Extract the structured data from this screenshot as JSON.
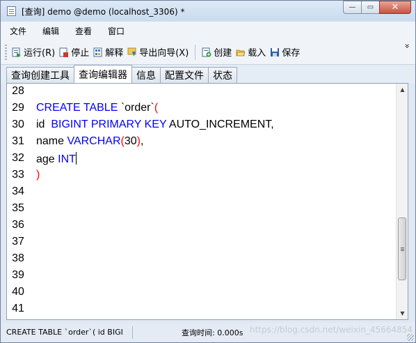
{
  "window": {
    "title": "[查询] demo @demo (localhost_3306) *",
    "minimize_label": "—",
    "restore_label": "▭",
    "close_label": "✕"
  },
  "menu": {
    "items": [
      {
        "label": "文件"
      },
      {
        "label": "编辑"
      },
      {
        "label": "查看"
      },
      {
        "label": "窗口"
      }
    ]
  },
  "toolbar": {
    "run": "运行(R)",
    "stop": "停止",
    "explain": "解释",
    "export_wizard": "导出向导(X)",
    "create": "创建",
    "load": "载入",
    "save": "保存",
    "overflow": "»"
  },
  "tabs": [
    {
      "label": "查询创建工具",
      "active": false
    },
    {
      "label": "查询编辑器",
      "active": true
    },
    {
      "label": "信息",
      "active": false
    },
    {
      "label": "配置文件",
      "active": false
    },
    {
      "label": "状态",
      "active": false
    }
  ],
  "editor": {
    "lines": [
      {
        "no": "28"
      },
      {
        "no": "29",
        "parts": [
          {
            "t": "CREATE TABLE ",
            "c": "kw"
          },
          {
            "t": "`order`",
            "c": ""
          },
          {
            "t": "(",
            "c": "paren"
          }
        ]
      },
      {
        "no": "30",
        "parts": [
          {
            "t": "id  ",
            "c": ""
          },
          {
            "t": "BIGINT PRIMARY KEY ",
            "c": "kw"
          },
          {
            "t": "AUTO_INCREMENT,",
            "c": ""
          }
        ]
      },
      {
        "no": "31",
        "parts": [
          {
            "t": "name ",
            "c": ""
          },
          {
            "t": "VARCHAR",
            "c": "kw"
          },
          {
            "t": "(",
            "c": "paren"
          },
          {
            "t": "30",
            "c": ""
          },
          {
            "t": ")",
            "c": "paren"
          },
          {
            "t": ",",
            "c": ""
          }
        ]
      },
      {
        "no": "32",
        "parts": [
          {
            "t": "age ",
            "c": ""
          },
          {
            "t": "INT",
            "c": "kw"
          }
        ],
        "cursor": true
      },
      {
        "no": "33",
        "parts": [
          {
            "t": ")",
            "c": "paren"
          }
        ]
      },
      {
        "no": "34"
      },
      {
        "no": "35"
      },
      {
        "no": "36"
      },
      {
        "no": "37"
      },
      {
        "no": "38"
      },
      {
        "no": "39"
      },
      {
        "no": "40"
      },
      {
        "no": "41"
      }
    ],
    "scroll_position": 0.82
  },
  "status": {
    "sql_preview": "CREATE TABLE `order`( id  BIGI",
    "query_time": "查询时间: 0.000s",
    "watermark": "https://blog.csdn.net/weixin_45664854"
  },
  "colors": {
    "keyword": "#0000ff",
    "paren": "#ff0000",
    "text": "#000000"
  }
}
